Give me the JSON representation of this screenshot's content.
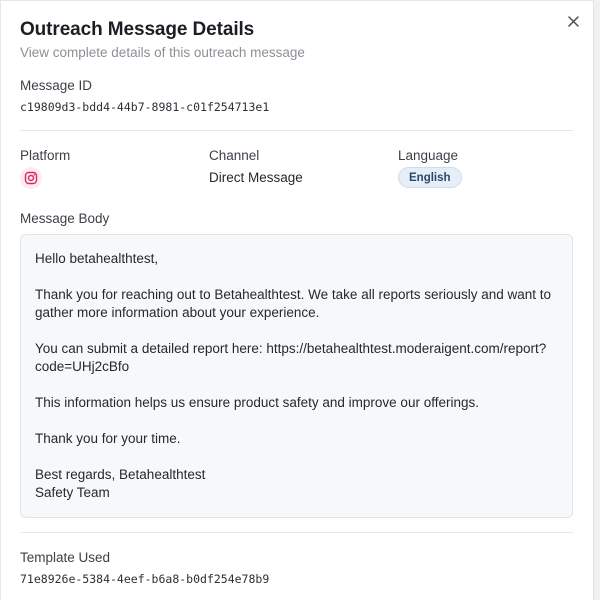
{
  "dialog": {
    "title": "Outreach Message Details",
    "subtitle": "View complete details of this outreach message",
    "close_icon": "close-icon"
  },
  "message_id": {
    "label": "Message ID",
    "value": "c19809d3-bdd4-44b7-8981-c01f254713e1"
  },
  "platform": {
    "label": "Platform",
    "icon": "instagram-icon",
    "icon_color": "#e1306c"
  },
  "channel": {
    "label": "Channel",
    "value": "Direct Message"
  },
  "language": {
    "label": "Language",
    "value": "English"
  },
  "message_body": {
    "label": "Message Body",
    "paragraphs": [
      "Hello betahealthtest,",
      "Thank you for reaching out to Betahealthtest. We take all reports seriously and want to gather more information about your experience.",
      "You can submit a detailed report here: https://betahealthtest.moderaigent.com/report?code=UHj2cBfo",
      "This information helps us ensure product safety and improve our offerings.",
      "Thank you for your time.",
      "Best regards, Betahealthtest Safety Team"
    ]
  },
  "template": {
    "label": "Template Used",
    "value": "71e8926e-5384-4eef-b6a8-b0df254e78b9"
  }
}
